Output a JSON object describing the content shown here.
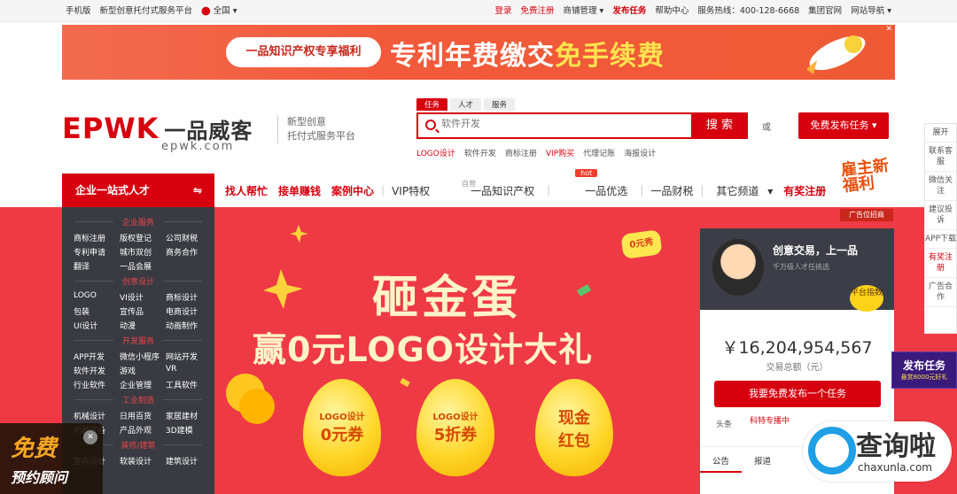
{
  "topbar": {
    "mobile": "手机版",
    "platform": "新型创意托付式服务平台",
    "city": "全国",
    "login": "登录",
    "register": "免费注册",
    "store": "商铺管理",
    "post_task": "发布任务",
    "help": "帮助中心",
    "hotline": "服务热线：400-128-6668",
    "group_site": "集团官网",
    "site_nav": "网站导航"
  },
  "banner": {
    "pill": "一品知识产权专享福利",
    "text": "专利年费缴交",
    "highlight": "免手续费"
  },
  "header": {
    "logo": "EPWK",
    "logo_cn": "一品威客",
    "logo_sub": "epwk.com",
    "slogan_1": "新型创意",
    "slogan_2": "托付式服务平台",
    "tabs": [
      "任务",
      "人才",
      "服务"
    ],
    "search_placeholder": "软件开发",
    "search_btn": "搜 索",
    "or": "或",
    "publish_btn": "免费发布任务",
    "keywords": [
      "LOGO设计",
      "软件开发",
      "商标注册",
      "VIP购买",
      "代理记账",
      "海报设计"
    ]
  },
  "nav": {
    "category": "企业一站式人才",
    "items": [
      "找人帮忙",
      "接单赚钱",
      "案例中心",
      "VIP特权",
      "一品知识产权",
      "一品优选",
      "一品财税",
      "其它频道",
      "有奖注册"
    ],
    "tag_ip": "自营",
    "tag_hot": "hot",
    "boss": "雇主新福利",
    "ad_tag": "广告位招商"
  },
  "sidemenu": [
    {
      "title": "企业服务",
      "items": [
        "商标注册",
        "版权登记",
        "公司财税",
        "专利申请",
        "城市双创",
        "商务合作",
        "翻译",
        "一品会展"
      ]
    },
    {
      "title": "创意设计",
      "items": [
        "LOGO",
        "VI设计",
        "商标设计",
        "包装",
        "宣传品",
        "电商设计",
        "UI设计",
        "动漫",
        "动画制作"
      ]
    },
    {
      "title": "开发服务",
      "items": [
        "APP开发",
        "微信小程序",
        "网站开发",
        "软件开发",
        "游戏",
        "VR",
        "行业软件",
        "企业管理",
        "工具软件"
      ]
    },
    {
      "title": "工业制造",
      "items": [
        "机械设计",
        "日用百货",
        "家居建材",
        "机械设备",
        "产品外观",
        "3D建模"
      ]
    },
    {
      "title": "装修/建筑",
      "items": [
        "室内设计",
        "软装设计",
        "建筑设计"
      ]
    }
  ],
  "hero": {
    "line1": "砸金蛋",
    "line2": "赢0元LOGO设计大礼",
    "badge": "0元秀",
    "eggs": [
      {
        "a": "LOGO设计",
        "b": "0元券"
      },
      {
        "a": "LOGO设计",
        "b": "5折券"
      },
      {
        "a": "现金",
        "b": "红包"
      }
    ]
  },
  "rightpanel": {
    "title": "创意交易，上一品",
    "subtitle": "千万级人才任挑选",
    "badge": "平台指数",
    "amount": "￥16,204,954,567",
    "amount_label": "交易总额（元）",
    "free_btn": "我要免费发布一个任务",
    "headline_label": "头条",
    "headline": "科特专播中",
    "tabs": [
      "公告",
      "报道"
    ]
  },
  "float": [
    "展开",
    "联系客服",
    "微信关注",
    "建议投诉",
    "APP下载",
    "有奖注册",
    "广告合作"
  ],
  "task_ad": {
    "title": "发布任务",
    "sub": "悬赏8000元好礼"
  },
  "consult": {
    "a": "免费",
    "b": "预约顾问"
  },
  "watermark": {
    "a": "查询啦",
    "b": "chaxunla.com"
  }
}
